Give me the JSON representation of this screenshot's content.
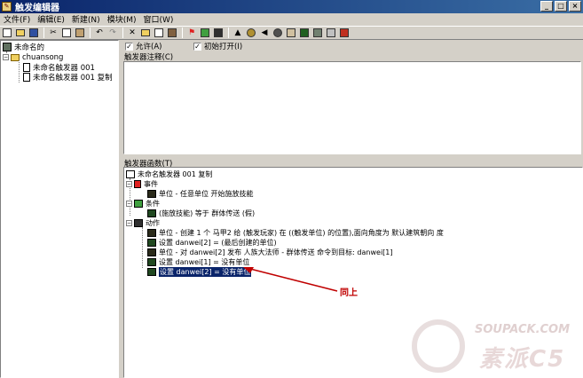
{
  "window": {
    "title": "触发编辑器"
  },
  "menu": [
    "文件(F)",
    "编辑(E)",
    "新建(N)",
    "模块(M)",
    "窗口(W)"
  ],
  "tree": {
    "root": "未命名的",
    "map": "chuansong",
    "items": [
      "未命名触发器 001",
      "未命名触发器 001 复制"
    ]
  },
  "options": {
    "enabled_label": "允许(A)",
    "enabled": true,
    "initially_on_label": "初始打开(I)",
    "initially_on": true
  },
  "comment": {
    "label": "触发器注释(C)",
    "text": ""
  },
  "functions": {
    "label": "触发器函数(T)",
    "trigger_name": "未命名触发器 001 复制",
    "events_label": "事件",
    "events": [
      "单位 - 任意单位 开始施放技能"
    ],
    "conditions_label": "条件",
    "conditions": [
      "(施放技能) 等于 群体传送 (假)"
    ],
    "actions_label": "动作",
    "actions": [
      "单位 - 创建 1 个 马甲2 给 (触发玩家) 在 ((触发单位) 的位置),面向角度为 默认建筑朝向 度",
      "设置 danwei[2] = (最后创建的单位)",
      "单位 - 对 danwei[2] 发布 人族大法师 - 群体传送 命令到目标: danwei[1]",
      "设置 danwei[1] = 没有单位",
      "设置 danwei[2] = 没有单位"
    ]
  },
  "annotation": {
    "text": "同上",
    "color": "#c00000"
  },
  "watermark": {
    "site": "SOUPACK.COM",
    "brand": "素派C5"
  }
}
